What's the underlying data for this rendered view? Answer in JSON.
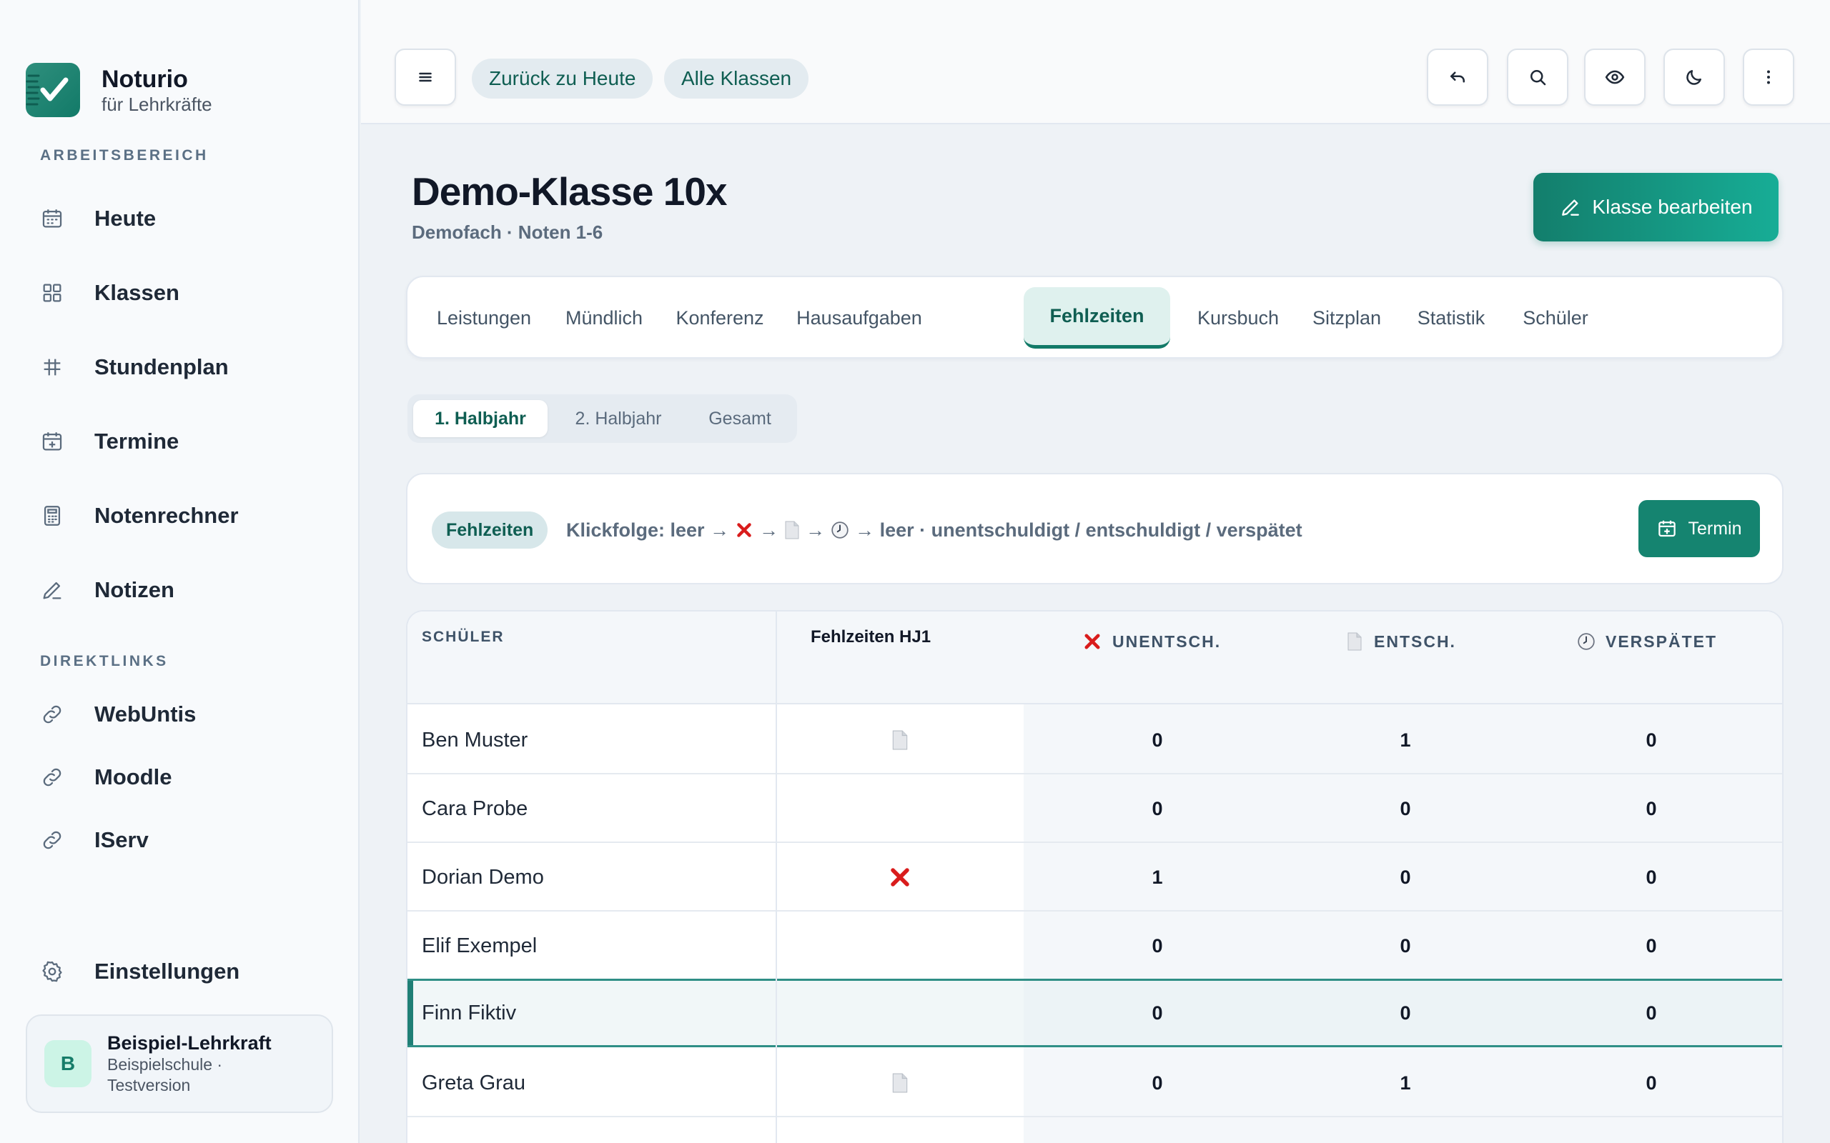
{
  "brand": {
    "name": "Noturio",
    "subtitle": "für Lehrkräfte"
  },
  "sidebar": {
    "workspace_label": "ARBEITSBEREICH",
    "items": [
      {
        "label": "Heute",
        "icon": "calendar-icon"
      },
      {
        "label": "Klassen",
        "icon": "grid-icon"
      },
      {
        "label": "Stundenplan",
        "icon": "table-icon"
      },
      {
        "label": "Termine",
        "icon": "calendar-plus-icon"
      },
      {
        "label": "Notenrechner",
        "icon": "calculator-icon"
      },
      {
        "label": "Notizen",
        "icon": "pencil-icon"
      }
    ],
    "links_label": "DIREKTLINKS",
    "links": [
      {
        "label": "WebUntis",
        "icon": "link-icon"
      },
      {
        "label": "Moodle",
        "icon": "link-icon"
      },
      {
        "label": "IServ",
        "icon": "link-icon"
      }
    ],
    "settings_label": "Einstellungen",
    "user": {
      "initial": "B",
      "name": "Beispiel-Lehrkraft",
      "meta": "Beispielschule · Testversion"
    }
  },
  "topbar": {
    "back_today": "Zurück zu Heute",
    "all_classes": "Alle Klassen",
    "actions": [
      "menu-icon",
      "undo-icon",
      "search-icon",
      "eye-icon",
      "moon-icon",
      "more-vertical-icon"
    ]
  },
  "header": {
    "title": "Demo-Klasse 10x",
    "subtitle": "Demofach · Noten 1-6",
    "edit_button": "Klasse bearbeiten"
  },
  "tabs": [
    {
      "label": "Leistungen",
      "active": false
    },
    {
      "label": "Mündlich",
      "active": false
    },
    {
      "label": "Konferenz",
      "active": false
    },
    {
      "label": "Hausaufgaben",
      "active": false
    },
    {
      "label": "Fehlzeiten",
      "active": true
    },
    {
      "label": "Kursbuch",
      "active": false
    },
    {
      "label": "Sitzplan",
      "active": false
    },
    {
      "label": "Statistik",
      "active": false
    },
    {
      "label": "Schüler",
      "active": false
    }
  ],
  "periods": [
    {
      "label": "1. Halbjahr",
      "active": true
    },
    {
      "label": "2. Halbjahr",
      "active": false
    },
    {
      "label": "Gesamt",
      "active": false
    }
  ],
  "legend": {
    "badge": "Fehlzeiten",
    "prefix": "Klickfolge: leer →",
    "arrow": "→",
    "suffix": "→ leer · unentschuldigt / entschuldigt / verspätet",
    "termin_button": "Termin"
  },
  "table": {
    "headers": {
      "student": "SCHÜLER",
      "absences": "Fehlzeiten HJ1",
      "unexcused": "UNENTSCH.",
      "excused": "ENTSCH.",
      "late": "VERSPÄTET"
    },
    "rows": [
      {
        "name": "Ben Muster",
        "mark": "excused",
        "unexcused": "0",
        "excused": "1",
        "late": "0",
        "selected": false
      },
      {
        "name": "Cara Probe",
        "mark": "",
        "unexcused": "0",
        "excused": "0",
        "late": "0",
        "selected": false
      },
      {
        "name": "Dorian Demo",
        "mark": "unexcused",
        "unexcused": "1",
        "excused": "0",
        "late": "0",
        "selected": false
      },
      {
        "name": "Elif Exempel",
        "mark": "",
        "unexcused": "0",
        "excused": "0",
        "late": "0",
        "selected": false
      },
      {
        "name": "Finn Fiktiv",
        "mark": "",
        "unexcused": "0",
        "excused": "0",
        "late": "0",
        "selected": true
      },
      {
        "name": "Greta Grau",
        "mark": "excused",
        "unexcused": "0",
        "excused": "1",
        "late": "0",
        "selected": false
      }
    ]
  },
  "colors": {
    "accent": "#127a68",
    "unexcused": "#d91c1c",
    "selected_border": "#2f8f86"
  }
}
